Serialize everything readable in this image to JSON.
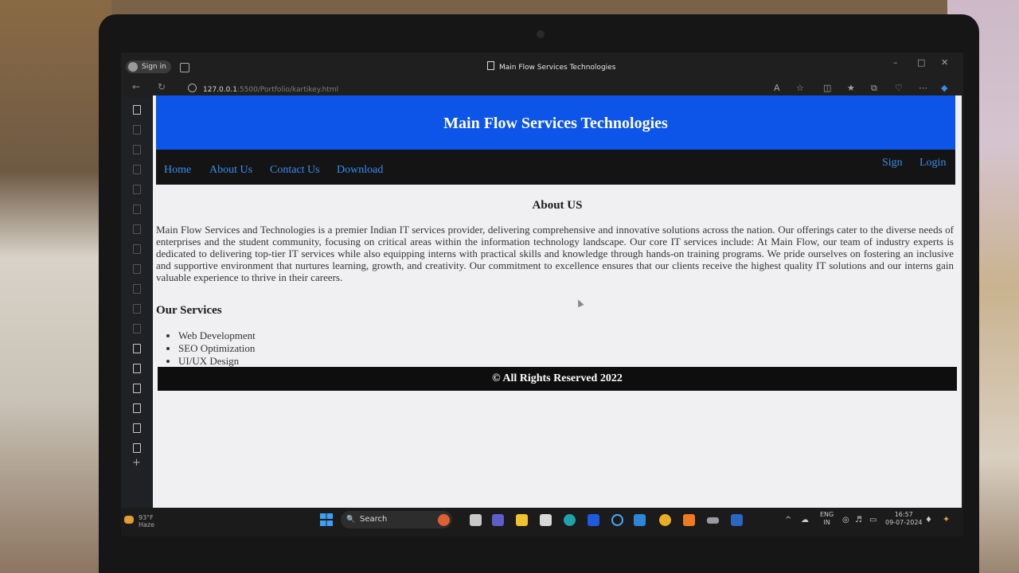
{
  "browser": {
    "sign_in_label": "Sign in",
    "tab_title": "Main Flow Services Technologies",
    "url_host": "127.0.0.1",
    "url_path": ":5500/Portfolio/kartikey.html"
  },
  "site": {
    "title": "Main Flow Services Technologies",
    "nav_left": [
      "Home",
      "About Us",
      "Contact Us",
      "Download"
    ],
    "nav_right": [
      "Sign",
      "Login"
    ],
    "about_heading": "About US",
    "about_text": "Main Flow Services and Technologies is a premier Indian IT services provider, delivering comprehensive and innovative solutions across the nation. Our offerings cater to the diverse needs of enterprises and the student community, focusing on critical areas within the information technology landscape. Our core IT services include: At Main Flow, our team of industry experts is dedicated to delivering top-tier IT services while also equipping interns with practical skills and knowledge through hands-on training programs. We pride ourselves on fostering an inclusive and supportive environment that nurtures learning, growth, and creativity. Our commitment to excellence ensures that our clients receive the highest quality IT solutions and our interns gain valuable experience to thrive in their careers.",
    "services_heading": "Our Services",
    "services": [
      "Web Development",
      "SEO Optimization",
      "UI/UX Design"
    ],
    "footer": "© All Rights Reserved 2022",
    "colors": {
      "header_bg": "#0d55e8",
      "nav_bg": "#141414",
      "nav_link": "#3a8ef0",
      "footer_bg": "#0e0e0e"
    }
  },
  "taskbar": {
    "weather_temp": "93°F",
    "weather_desc": "Haze",
    "search_label": "Search",
    "language": "ENG",
    "region": "IN",
    "time": "16:57",
    "date": "09-07-2024"
  }
}
